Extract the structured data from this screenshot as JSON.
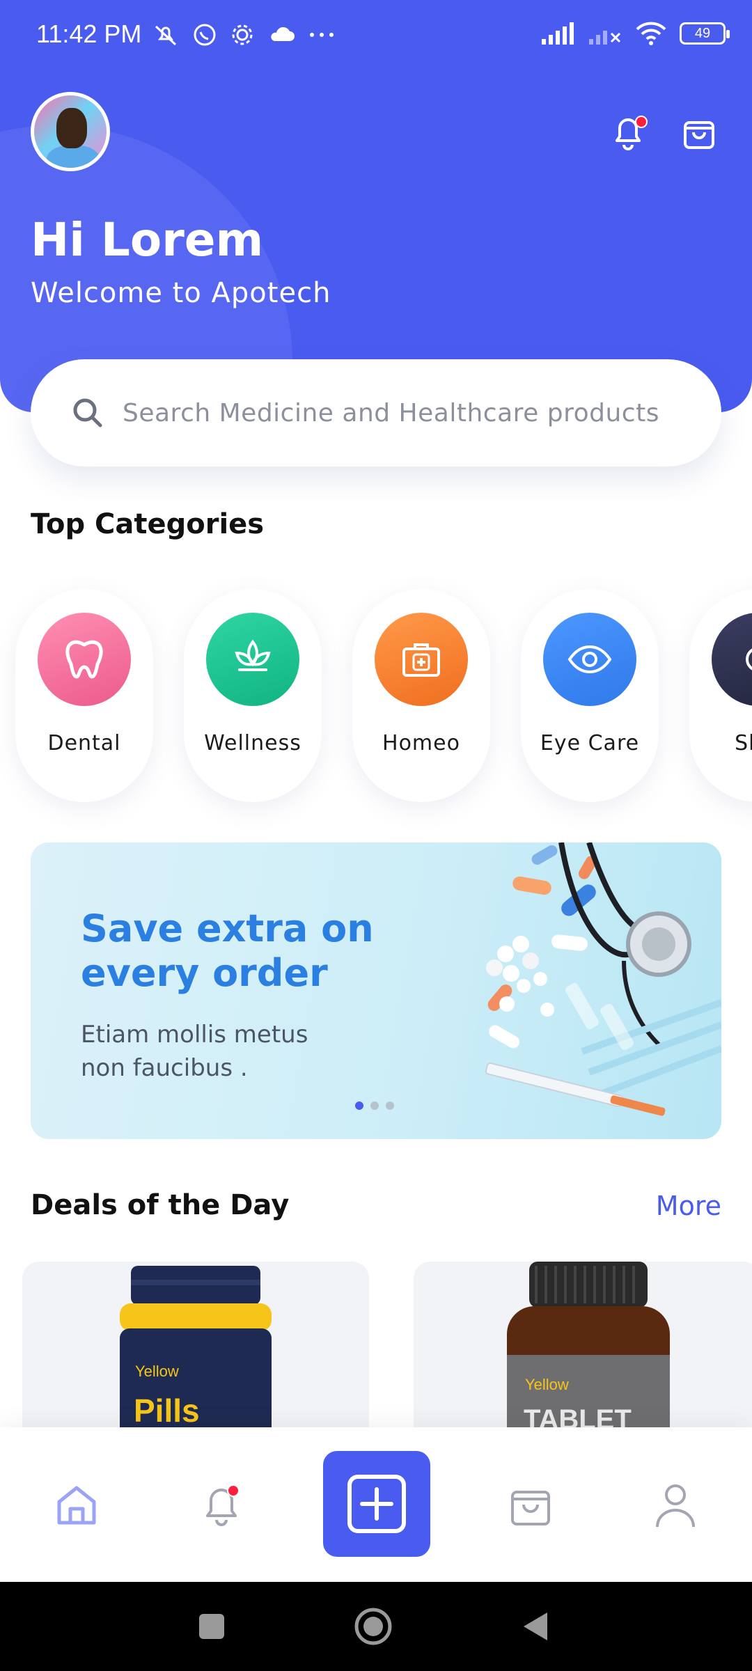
{
  "status_bar": {
    "time": "11:42 PM",
    "battery": "49",
    "icons_left": [
      "mute-icon",
      "whatsapp-icon",
      "settings-icon",
      "cloud-icon",
      "more-dots-icon"
    ],
    "icons_right": [
      "signal-icon",
      "signal-no-service-icon",
      "wifi-icon",
      "battery-icon"
    ]
  },
  "header": {
    "greeting": "Hi Lorem",
    "welcome": "Welcome to Apotech",
    "notification_badge": true
  },
  "search": {
    "placeholder": "Search Medicine and Healthcare products"
  },
  "categories": {
    "title": "Top Categories",
    "items": [
      {
        "label": "Dental",
        "icon": "tooth-icon",
        "color": "#F06598"
      },
      {
        "label": "Wellness",
        "icon": "leaf-icon",
        "color": "#1BC08E"
      },
      {
        "label": "Homeo",
        "icon": "medical-kit-icon",
        "color": "#F77A2B"
      },
      {
        "label": "Eye Care",
        "icon": "eye-icon",
        "color": "#3C86F2"
      },
      {
        "label": "Skin",
        "icon": "skin-icon",
        "color": "#2B2D49"
      }
    ]
  },
  "banner": {
    "title_line1": "Save extra on",
    "title_line2": "every order",
    "sub_line1": "Etiam mollis metus",
    "sub_line2": "non faucibus .",
    "active_slide": 1,
    "slides": 3
  },
  "deals": {
    "title": "Deals of the Day",
    "more": "More",
    "products": [
      {
        "brand": "Yellow",
        "name": "Pills"
      },
      {
        "brand": "Yellow",
        "name": "TABLET"
      }
    ]
  },
  "bottom_nav": {
    "items": [
      "home-icon",
      "bell-icon",
      "add-icon",
      "bag-icon",
      "profile-icon"
    ],
    "active": "home-icon"
  },
  "colors": {
    "primary": "#4A5BF0",
    "accent_text": "#2A7FE0",
    "badge": "#FF1F3D"
  }
}
